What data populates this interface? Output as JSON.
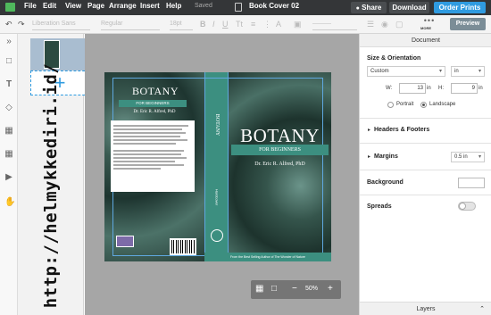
{
  "menu": {
    "items": [
      "File",
      "Edit",
      "View",
      "Page",
      "Arrange",
      "Insert",
      "Help"
    ],
    "status": "Saved",
    "document_title": "Book Cover 02"
  },
  "header_actions": {
    "share": "Share",
    "download": "Download",
    "order": "Order Prints"
  },
  "toolbar": {
    "font": "Liberation Sans",
    "weight": "Regular",
    "size": "18pt",
    "more": "MORE",
    "preview": "Preview"
  },
  "watermark": "http://helmykkediri.id/",
  "cover": {
    "back_title": "BOTANY",
    "back_subtitle": "FOR BEGINNERS",
    "back_author": "Dr. Eric R. Alfred, PhD",
    "spine_title": "BOTANY",
    "spine_sub": "Hardcover",
    "front_title": "BOTANY",
    "front_subtitle": "FOR BEGINNERS",
    "front_author": "Dr. Eric R. Alfred, PhD",
    "bottom_strip": "From the Best Selling Author of The Wonder of Nature"
  },
  "zoom": {
    "value": "50%"
  },
  "panel": {
    "header": "Document",
    "size_section": "Size & Orientation",
    "preset": "Custom",
    "unit": "in",
    "width_label": "W:",
    "width_value": "13",
    "width_unit": "in",
    "height_label": "H:",
    "height_value": "9",
    "height_unit": "in",
    "portrait": "Portrait",
    "landscape": "Landscape",
    "orientation_selected": "Landscape",
    "headers_footers": "Headers & Footers",
    "margins": "Margins",
    "margin_value": "0.5 in",
    "background": "Background",
    "spreads": "Spreads",
    "spreads_on": false,
    "layers": "Layers"
  },
  "colors": {
    "topbar": "#343638",
    "order_button": "#2f9be0",
    "preview_button": "#7b8d97",
    "cover_accent": "#3c8f80",
    "canvas_bg": "#a6a6a6"
  }
}
